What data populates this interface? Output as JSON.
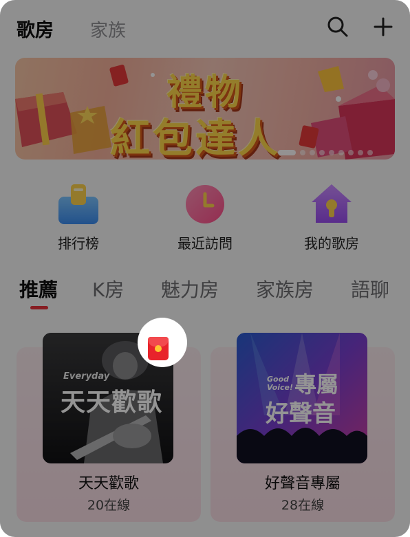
{
  "header": {
    "tab_active": "歌房",
    "tab_inactive": "家族",
    "search_icon": "search-icon",
    "add_icon": "plus-icon"
  },
  "banner": {
    "line1": "禮物",
    "line2": "紅包達人",
    "page_dots": 9,
    "active_dot": 1
  },
  "quick_entries": [
    {
      "label": "排行榜",
      "icon": "ranking-icon"
    },
    {
      "label": "最近訪問",
      "icon": "clock-icon"
    },
    {
      "label": "我的歌房",
      "icon": "house-icon"
    }
  ],
  "categories": [
    "推薦",
    "K房",
    "魅力房",
    "家族房",
    "語聊"
  ],
  "active_category": "推薦",
  "rooms": [
    {
      "cover_tag": "Everyday",
      "cover_title": "天天歡歌",
      "title": "天天歡歌",
      "online": "20在線",
      "has_redpack": true
    },
    {
      "cover_tag": "Good Voice!",
      "cover_title_1": "專屬",
      "cover_title_2": "好聲音",
      "title": "好聲音專屬",
      "online": "28在線",
      "has_redpack": false
    }
  ],
  "colors": {
    "accent": "#e8323c",
    "banner_text": "#ffd84a",
    "card_bg": "#f8e0e6"
  }
}
